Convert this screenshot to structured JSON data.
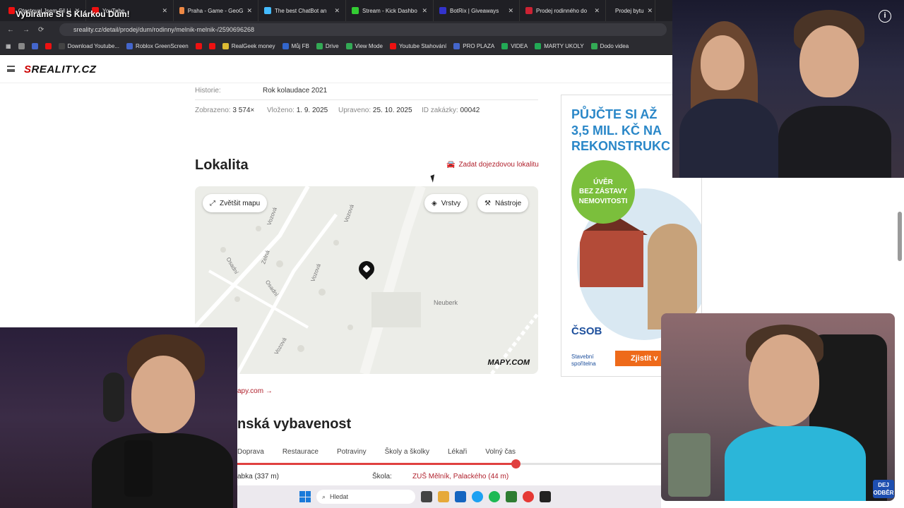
{
  "stream": {
    "title": "Vybíráme Si S Klárkou Dům!"
  },
  "browser": {
    "tabs": [
      {
        "label": "Otestoval Jsem Sil Li",
        "color": "#e11"
      },
      {
        "label": "YouTube",
        "color": "#e11"
      },
      {
        "label": "Praha - Game - GeoG",
        "color": "#e84"
      },
      {
        "label": "The best ChatBot an",
        "color": "#4bf"
      },
      {
        "label": "Stream - Kick Dashbo",
        "color": "#3c3"
      },
      {
        "label": "BotRix | Giveaways",
        "color": "#33c"
      },
      {
        "label": "Prodej rodinného do",
        "color": "#c23"
      },
      {
        "label": "Prodej bytu",
        "color": "#c23"
      }
    ],
    "url": "sreality.cz/detail/prodej/dum/rodinny/melnik-melnik-/2590696268",
    "bookmarks": [
      {
        "label": "",
        "color": "#888"
      },
      {
        "label": "",
        "color": "#46c"
      },
      {
        "label": "",
        "color": "#e11"
      },
      {
        "label": "Download Youtube...",
        "color": "#444"
      },
      {
        "label": "Roblox GreenScreen",
        "color": "#46c"
      },
      {
        "label": "",
        "color": "#e11"
      },
      {
        "label": "",
        "color": "#e11"
      },
      {
        "label": "RealGeek money",
        "color": "#db3"
      },
      {
        "label": "Můj FB",
        "color": "#36c"
      },
      {
        "label": "Drive",
        "color": "#3a5"
      },
      {
        "label": "View Mode",
        "color": "#3a5"
      },
      {
        "label": "Youtube Stahování",
        "color": "#e11"
      },
      {
        "label": "PRO PLAZA",
        "color": "#46c"
      },
      {
        "label": "VIDEA",
        "color": "#2a5"
      },
      {
        "label": "MARTY UKOLY",
        "color": "#2a5"
      },
      {
        "label": "Dodo videa",
        "color": "#3a5"
      }
    ]
  },
  "listing": {
    "history_label": "Historie:",
    "history_value": "Rok kolaudace 2021",
    "viewed_label": "Zobrazeno:",
    "viewed_value": "3 574×",
    "inserted_label": "Vloženo:",
    "inserted_value": "1. 9. 2025",
    "edited_label": "Upraveno:",
    "edited_value": "25. 10. 2025",
    "order_label": "ID zakázky:",
    "order_value": "00042"
  },
  "locality": {
    "heading": "Lokalita",
    "commute_link": "Zadat dojezdovou lokalitu",
    "map": {
      "enlarge": "Zvětšit mapu",
      "layers": "Vrstvy",
      "tools": "Nástroje",
      "area_label": "Neuberk",
      "streets": [
        "Osadní",
        "Osadní",
        "Zelná",
        "Vozová",
        "Vozová",
        "Vozová",
        "Vozová"
      ],
      "brand": "MAPY.COM"
    },
    "maplink": "apy.com →"
  },
  "amenities": {
    "heading": "nská vybavenost",
    "tabs": [
      "Doprava",
      "Restaurace",
      "Potraviny",
      "Školy a školky",
      "Lékaři",
      "Volný čas"
    ],
    "row_left": "abka (337 m)",
    "row_label": "Škola:",
    "row_value": "ZUŠ Mělník, Palackého (44 m)"
  },
  "ad": {
    "headline": [
      "PŮJČTE SI AŽ",
      "3,5 MIL. KČ NA",
      "REKONSTRUKC"
    ],
    "badge": [
      "ÚVĚR",
      "BEZ ZÁSTAVY",
      "NEMOVITOSTI"
    ],
    "brand": "ČSOB",
    "brand_sub": [
      "Stavební",
      "spořitelna"
    ],
    "cta": "Zjistit v"
  },
  "taskbar": {
    "search_placeholder": "Hledat"
  },
  "overlay": {
    "subscribe": "DEJ ODBĚR"
  }
}
